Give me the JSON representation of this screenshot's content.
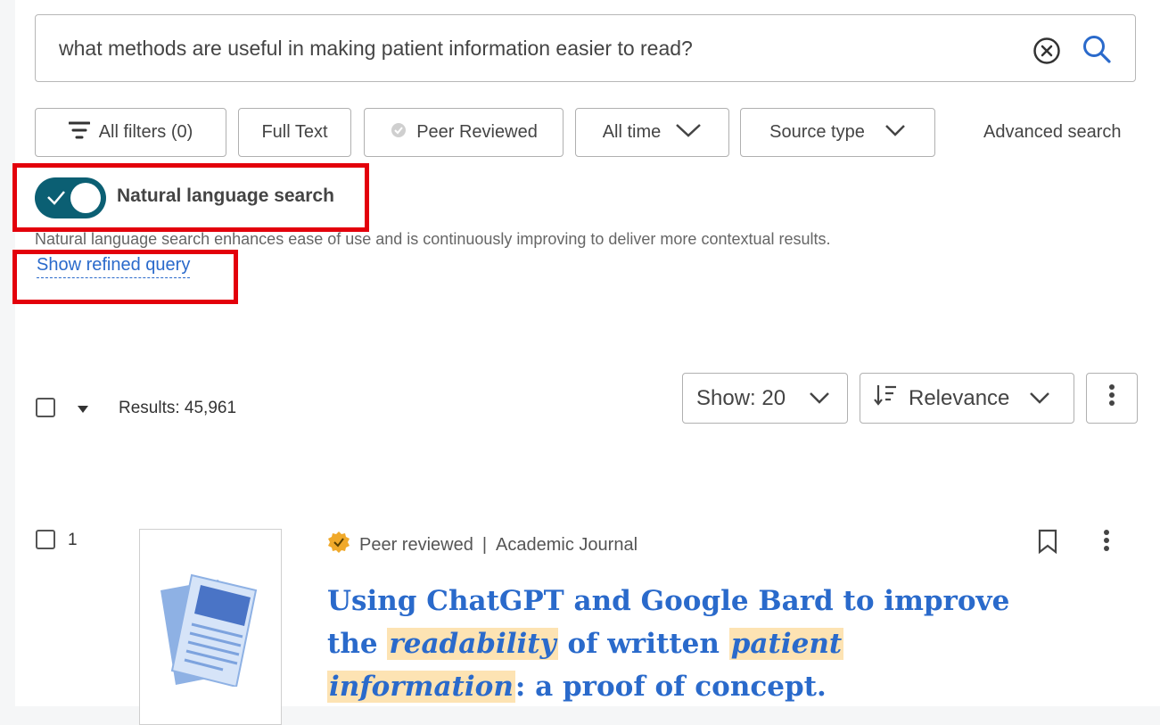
{
  "search": {
    "query": "what methods are useful in making patient information easier to read?",
    "clear_icon": "clear-circle-icon",
    "search_icon": "search-icon"
  },
  "filters": {
    "all_filters": "All filters (0)",
    "full_text": "Full Text",
    "peer_reviewed": "Peer Reviewed",
    "all_time": "All time",
    "source_type": "Source type",
    "advanced_search": "Advanced search"
  },
  "natural_language": {
    "label": "Natural language search",
    "enabled": true,
    "description": "Natural language search enhances ease of use and is continuously improving to deliver more contextual results.",
    "show_refined_query": "Show refined query"
  },
  "results_bar": {
    "results_text": "Results: 45,961",
    "show": "Show: 20",
    "sort": "Relevance"
  },
  "result": {
    "number": "1",
    "peer_reviewed": "Peer reviewed",
    "separator": "|",
    "source_type": "Academic Journal",
    "title_parts": {
      "p1": "Using ChatGPT and Google Bard to improve the",
      "h1": "readability",
      "p2": "of written",
      "h2": "patient",
      "h3": "information",
      "p3": ": a proof of concept."
    }
  },
  "colors": {
    "accent_blue": "#2a6acb",
    "toggle_teal": "#0b5f73",
    "highlight": "#fde3b3",
    "annotation_red": "#e3000b",
    "badge_gold": "#f0a92a"
  }
}
